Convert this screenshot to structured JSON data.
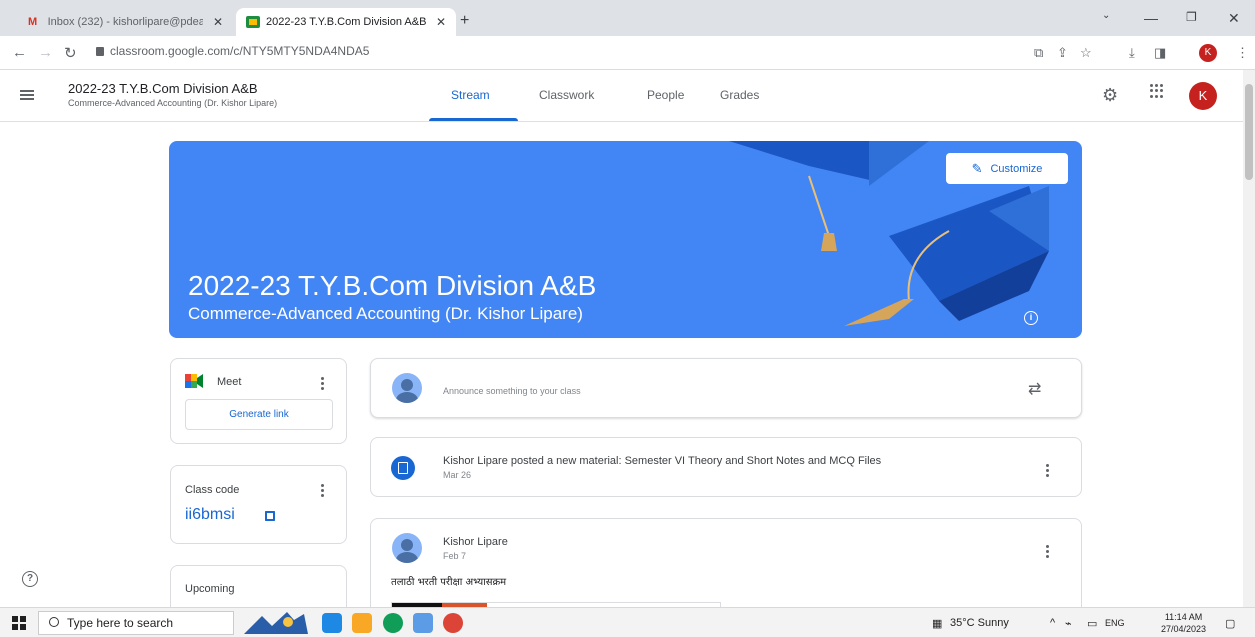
{
  "browser": {
    "tabs": [
      {
        "title": "Inbox (232) - kishorlipare@pdea",
        "close": "✕"
      },
      {
        "title": "2022-23 T.Y.B.Com Division A&B",
        "close": "✕"
      }
    ],
    "new_tab": "+",
    "url": "classroom.google.com/c/NTY5MTY5NDA4NDA5",
    "profile_initial": "K"
  },
  "header": {
    "class_title": "2022-23 T.Y.B.Com Division A&B",
    "class_subtitle": "Commerce-Advanced Accounting (Dr. Kishor Lipare)",
    "tabs": [
      "Stream",
      "Classwork",
      "People",
      "Grades"
    ],
    "active_tab": "Stream",
    "avatar_initial": "K"
  },
  "banner": {
    "title": "2022-23 T.Y.B.Com Division A&B",
    "subtitle": "Commerce-Advanced Accounting (Dr. Kishor Lipare)",
    "customize_label": "Customize",
    "color": "#4285f4"
  },
  "sidebar": {
    "meet": {
      "label": "Meet",
      "button": "Generate link"
    },
    "class_code": {
      "label": "Class code",
      "code": "ii6bmsi"
    },
    "upcoming": {
      "label": "Upcoming"
    }
  },
  "stream": {
    "announce_placeholder": "Announce something to your class",
    "posts": [
      {
        "title": "Kishor Lipare posted a new material: Semester VI Theory and Short Notes and MCQ Files",
        "date": "Mar 26"
      },
      {
        "author": "Kishor Lipare",
        "date": "Feb 7",
        "body": "तलाठी भरती परीक्षा अभ्यासक्रम"
      }
    ]
  },
  "taskbar": {
    "search_placeholder": "Type here to search",
    "weather": "35°C Sunny",
    "language": "ENG",
    "time": "11:14 AM",
    "date": "27/04/2023"
  },
  "colors": {
    "accent": "#1967d2",
    "banner": "#4285f4"
  }
}
